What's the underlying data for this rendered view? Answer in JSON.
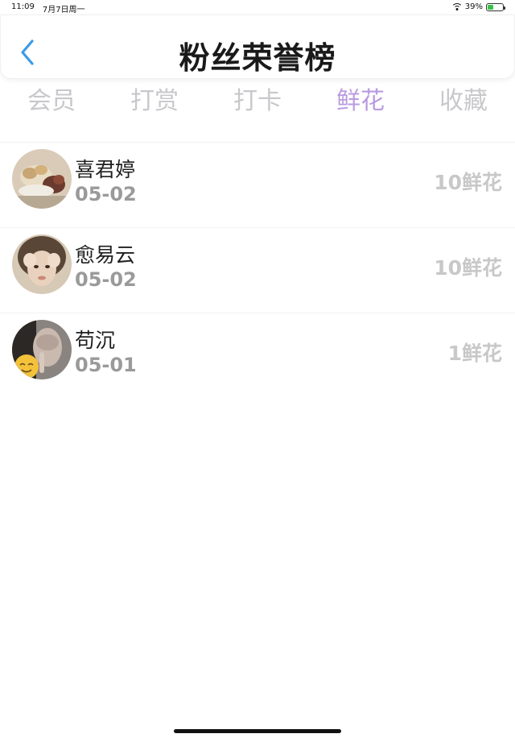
{
  "status_bar": {
    "time": "11:09",
    "date": "7月7日周一",
    "battery_percent": "39%",
    "battery_level": 0.39
  },
  "header": {
    "title": "粉丝荣誉榜",
    "back_icon": "chevron-left-icon"
  },
  "tabs": [
    {
      "label": "会员",
      "active": false
    },
    {
      "label": "打赏",
      "active": false
    },
    {
      "label": "打卡",
      "active": false
    },
    {
      "label": "鲜花",
      "active": true
    },
    {
      "label": "收藏",
      "active": false
    }
  ],
  "colors": {
    "accent": "#b99be0",
    "back_icon": "#3a9be8",
    "inactive_tab": "#c8c8cc"
  },
  "fans": [
    {
      "name": "喜君婷",
      "date": "05-02",
      "amount": "10鲜花"
    },
    {
      "name": "愈易云",
      "date": "05-02",
      "amount": "10鲜花"
    },
    {
      "name": "苟沉",
      "date": "05-01",
      "amount": "1鲜花"
    }
  ]
}
